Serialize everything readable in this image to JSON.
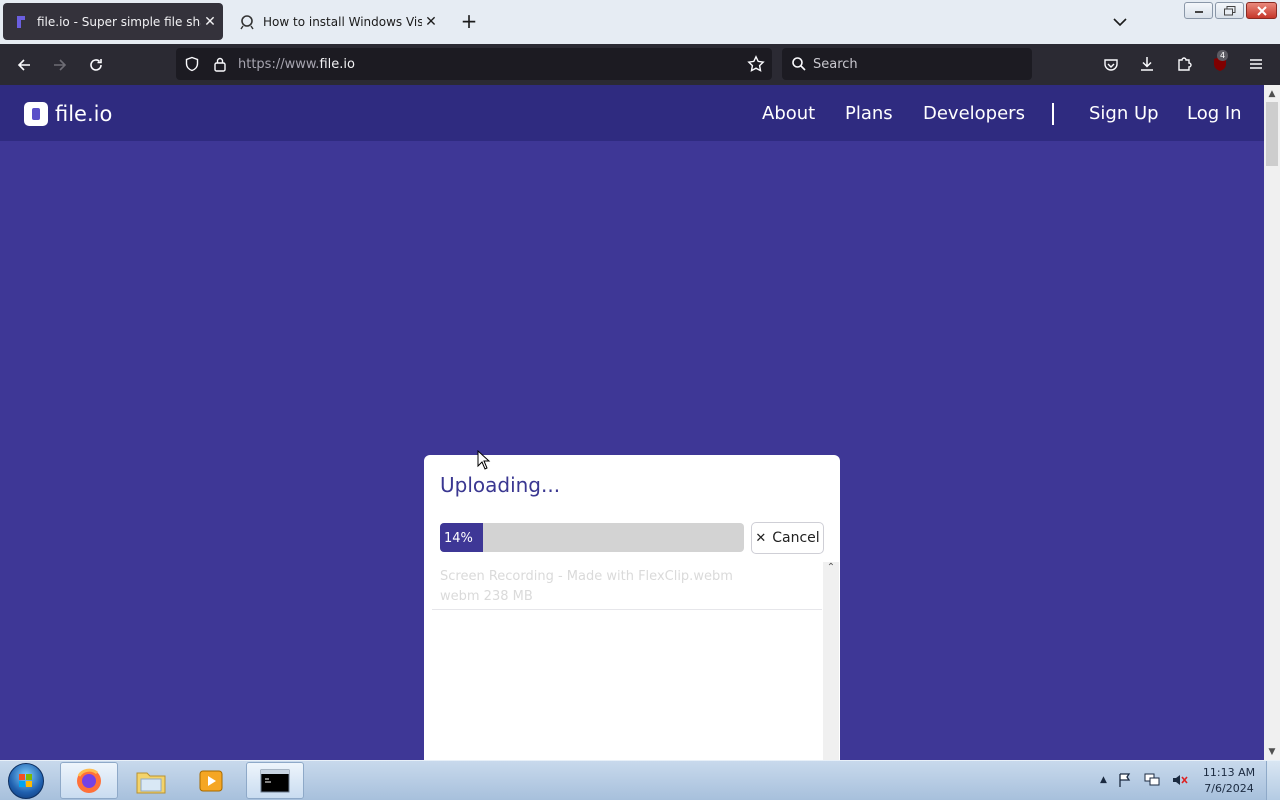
{
  "browser": {
    "tabs": [
      {
        "title": "file.io - Super simple file sharing",
        "active": true
      },
      {
        "title": "How to install Windows Vista in",
        "active": false
      }
    ],
    "url_prefix": "https://www.",
    "url_domain": "file.io",
    "search_placeholder": "Search",
    "extension_badge": "4"
  },
  "site": {
    "logo": "file.io",
    "nav": {
      "about": "About",
      "plans": "Plans",
      "developers": "Developers",
      "signup": "Sign Up",
      "login": "Log In"
    }
  },
  "upload": {
    "title": "Uploading...",
    "progress_percent": 14,
    "progress_label": "14%",
    "cancel_label": "Cancel",
    "file_name": "Screen Recording - Made with FlexClip.webm",
    "file_meta": "webm 238 MB"
  },
  "taskbar": {
    "time": "11:13 AM",
    "date": "7/6/2024"
  },
  "colors": {
    "page_bg": "#3e3796",
    "header_bg": "#2f2b80",
    "accent": "#3a3791"
  }
}
